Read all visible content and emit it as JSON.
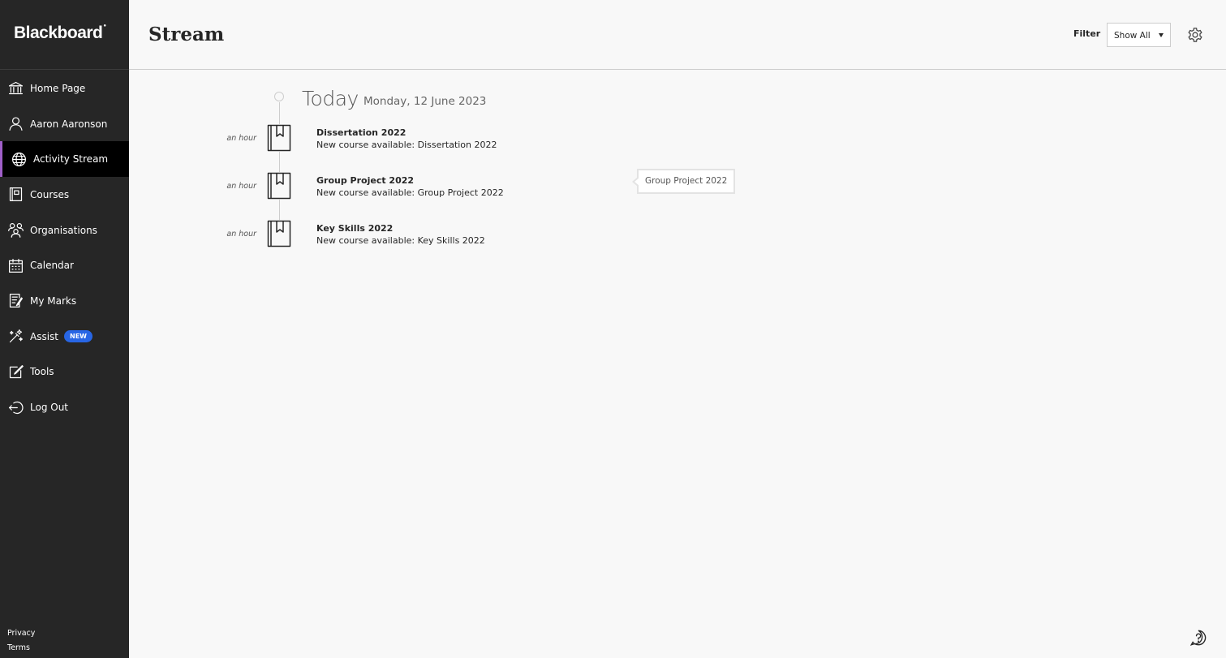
{
  "app": {
    "brand": "Blackboard"
  },
  "sidebar": {
    "items": [
      {
        "label": "Home Page",
        "icon": "institution-icon"
      },
      {
        "label": "Aaron Aaronson",
        "icon": "user-icon"
      },
      {
        "label": "Activity Stream",
        "icon": "globe-icon",
        "active": true
      },
      {
        "label": "Courses",
        "icon": "courses-icon"
      },
      {
        "label": "Organisations",
        "icon": "organisations-icon"
      },
      {
        "label": "Calendar",
        "icon": "calendar-icon"
      },
      {
        "label": "My Marks",
        "icon": "marks-icon"
      },
      {
        "label": "Assist",
        "icon": "assist-icon",
        "badge": "NEW"
      },
      {
        "label": "Tools",
        "icon": "tools-icon"
      },
      {
        "label": "Log Out",
        "icon": "logout-icon"
      }
    ],
    "footer": {
      "privacy": "Privacy",
      "terms": "Terms"
    }
  },
  "header": {
    "title": "Stream",
    "filter_label": "Filter",
    "filter_value": "Show All",
    "settings_icon": "gear-icon"
  },
  "stream": {
    "day_label": "Today",
    "date": "Monday, 12 June 2023",
    "entries": [
      {
        "time": "an hour",
        "title": "Dissertation 2022",
        "description": "New course available: Dissertation 2022",
        "icon": "course-book-icon"
      },
      {
        "time": "an hour",
        "title": "Group Project 2022",
        "description": "New course available: Group Project 2022",
        "icon": "course-book-icon"
      },
      {
        "time": "an hour",
        "title": "Key Skills 2022",
        "description": "New course available: Key Skills 2022",
        "icon": "course-book-icon"
      }
    ],
    "tooltip": "Group Project 2022"
  },
  "help_icon": "help-icon",
  "colors": {
    "sidebar_bg": "#262626",
    "active_accent": "#a05fc9",
    "badge_blue": "#2866e5",
    "page_bg": "#f8f8f8"
  }
}
